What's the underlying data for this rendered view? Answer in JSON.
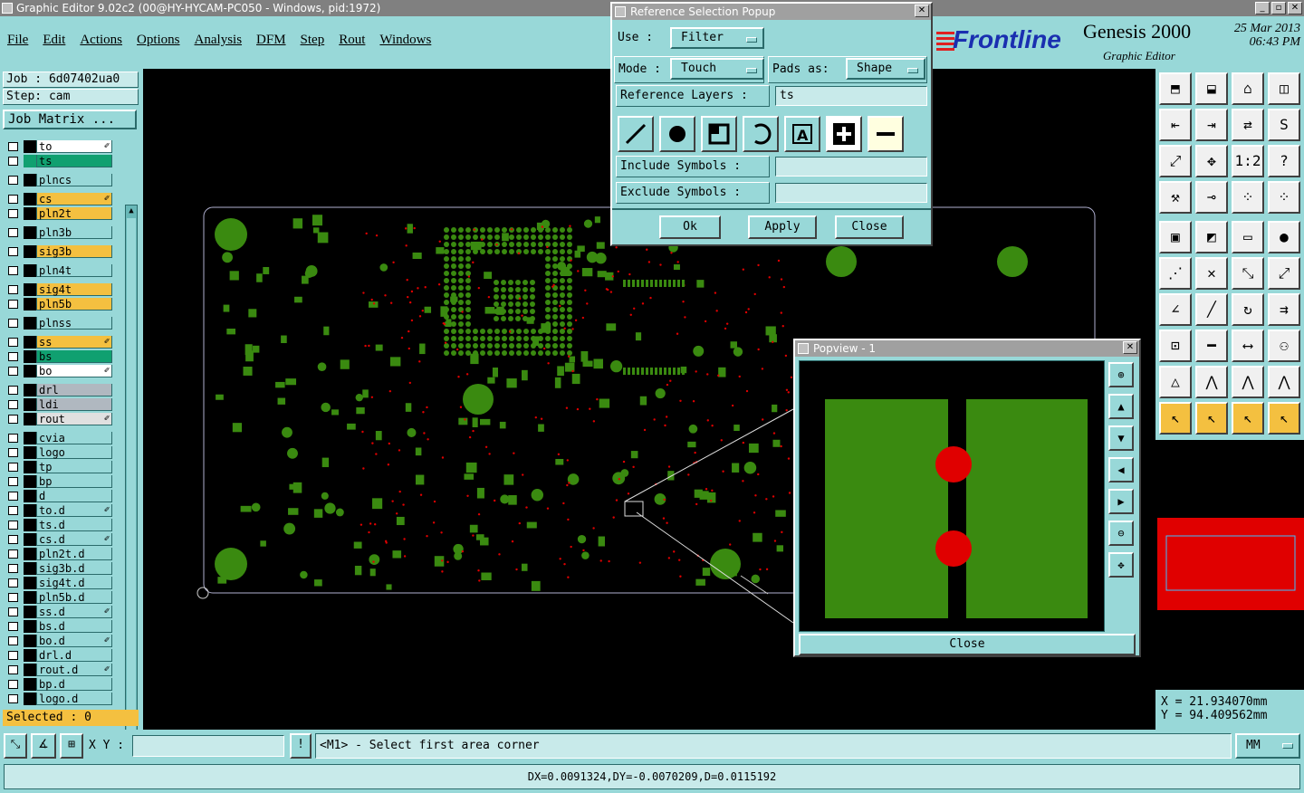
{
  "window": {
    "title": "Graphic Editor 9.02c2 (00@HY-HYCAM-PC050 - Windows, pid:1972)"
  },
  "menu": [
    "File",
    "Edit",
    "Actions",
    "Options",
    "Analysis",
    "DFM",
    "Step",
    "Rout",
    "Windows"
  ],
  "brand": {
    "logo": "Frontline",
    "product": "Genesis 2000",
    "date": "25 Mar 2013",
    "time": "06:43 PM",
    "subtitle": "Graphic Editor"
  },
  "job": {
    "job_label": "Job : 6d07402ua0",
    "step_label": "Step: cam",
    "matrix_button": "Job Matrix ..."
  },
  "layers": [
    {
      "name": "to",
      "color": "#ffffff",
      "mark": "✐",
      "swatch": "#000000"
    },
    {
      "name": "ts",
      "color": "#10a070",
      "mark": "",
      "swatch": "#10a070"
    },
    {
      "name": "plncs",
      "color": "#98d8d8",
      "mark": "",
      "swatch": "#000000"
    },
    {
      "name": "cs",
      "color": "#f4c040",
      "mark": "✐",
      "swatch": "#000000"
    },
    {
      "name": "pln2t",
      "color": "#f4c040",
      "mark": "",
      "swatch": "#000000"
    },
    {
      "name": "pln3b",
      "color": "#98d8d8",
      "mark": "",
      "swatch": "#000000"
    },
    {
      "name": "sig3b",
      "color": "#f4c040",
      "mark": "",
      "swatch": "#000000"
    },
    {
      "name": "pln4t",
      "color": "#98d8d8",
      "mark": "",
      "swatch": "#000000"
    },
    {
      "name": "sig4t",
      "color": "#f4c040",
      "mark": "",
      "swatch": "#000000"
    },
    {
      "name": "pln5b",
      "color": "#f4c040",
      "mark": "",
      "swatch": "#000000"
    },
    {
      "name": "plnss",
      "color": "#98d8d8",
      "mark": "",
      "swatch": "#000000"
    },
    {
      "name": "ss",
      "color": "#f4c040",
      "mark": "✐",
      "swatch": "#000000"
    },
    {
      "name": "bs",
      "color": "#10a070",
      "mark": "",
      "swatch": "#000000"
    },
    {
      "name": "bo",
      "color": "#ffffff",
      "mark": "✐",
      "swatch": "#000000"
    },
    {
      "name": "drl",
      "color": "#b0b8c0",
      "mark": "",
      "swatch": "#000000"
    },
    {
      "name": "ldi",
      "color": "#b0b8c0",
      "mark": "",
      "swatch": "#000000"
    },
    {
      "name": "rout",
      "color": "#e0e0e0",
      "mark": "✐",
      "swatch": "#000000"
    },
    {
      "name": "cvia",
      "color": "#98d8d8",
      "mark": "",
      "swatch": "#000000"
    },
    {
      "name": "logo",
      "color": "#98d8d8",
      "mark": "",
      "swatch": "#000000"
    },
    {
      "name": "tp",
      "color": "#98d8d8",
      "mark": "",
      "swatch": "#000000"
    },
    {
      "name": "bp",
      "color": "#98d8d8",
      "mark": "",
      "swatch": "#000000"
    },
    {
      "name": "d",
      "color": "#98d8d8",
      "mark": "",
      "swatch": "#000000"
    },
    {
      "name": "to.d",
      "color": "#98d8d8",
      "mark": "✐",
      "swatch": "#000000"
    },
    {
      "name": "ts.d",
      "color": "#98d8d8",
      "mark": "",
      "swatch": "#000000"
    },
    {
      "name": "cs.d",
      "color": "#98d8d8",
      "mark": "✐",
      "swatch": "#000000"
    },
    {
      "name": "pln2t.d",
      "color": "#98d8d8",
      "mark": "",
      "swatch": "#000000"
    },
    {
      "name": "sig3b.d",
      "color": "#98d8d8",
      "mark": "",
      "swatch": "#000000"
    },
    {
      "name": "sig4t.d",
      "color": "#98d8d8",
      "mark": "",
      "swatch": "#000000"
    },
    {
      "name": "pln5b.d",
      "color": "#98d8d8",
      "mark": "",
      "swatch": "#000000"
    },
    {
      "name": "ss.d",
      "color": "#98d8d8",
      "mark": "✐",
      "swatch": "#000000"
    },
    {
      "name": "bs.d",
      "color": "#98d8d8",
      "mark": "",
      "swatch": "#000000"
    },
    {
      "name": "bo.d",
      "color": "#98d8d8",
      "mark": "✐",
      "swatch": "#000000"
    },
    {
      "name": "drl.d",
      "color": "#98d8d8",
      "mark": "",
      "swatch": "#000000"
    },
    {
      "name": "rout.d",
      "color": "#98d8d8",
      "mark": "✐",
      "swatch": "#000000"
    },
    {
      "name": "bp.d",
      "color": "#98d8d8",
      "mark": "",
      "swatch": "#000000"
    },
    {
      "name": "logo.d",
      "color": "#98d8d8",
      "mark": "",
      "swatch": "#000000"
    }
  ],
  "selected": "Selected : 0",
  "coords": {
    "x": "X =  21.934070mm",
    "y": "Y =  94.409562mm"
  },
  "bottombar": {
    "xy_label": "X Y :",
    "xy_value": "",
    "prompt": "<M1> - Select first area corner",
    "units": "MM"
  },
  "status": "DX=0.0091324,DY=-0.0070209,D=0.0115192",
  "ref_popup": {
    "title": "Reference Selection Popup",
    "use_label": "Use   :",
    "use_value": "Filter",
    "mode_label": "Mode  :",
    "mode_value": "Touch",
    "pads_label": "Pads as:",
    "pads_value": "Shape",
    "ref_layers_label": "Reference Layers  :",
    "ref_layers_value": "ts",
    "include_label": "Include Symbols  :",
    "include_value": "",
    "exclude_label": "Exclude Symbols  :",
    "exclude_value": "",
    "ok": "Ok",
    "apply": "Apply",
    "close": "Close"
  },
  "popview": {
    "title": "Popview - 1",
    "close": "Close"
  },
  "colors": {
    "board_green": "#3a8a10",
    "pad_red": "#e00000",
    "panel_teal": "#98d8d8"
  }
}
